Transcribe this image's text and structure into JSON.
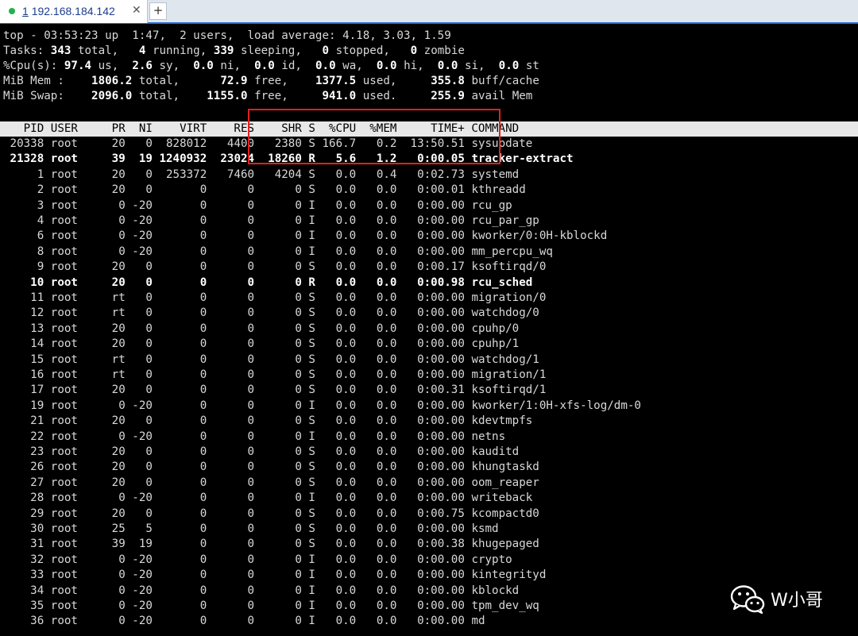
{
  "tab": {
    "number": "1",
    "host": "192.168.184.142",
    "close_glyph": "✕",
    "add_glyph": "+"
  },
  "summary": {
    "line1": "top - 03:53:23 up  1:47,  2 users,  load average: 4.18, 3.03, 1.59",
    "tasks": {
      "label": "Tasks:",
      "total": "343",
      "total_label": "total,",
      "running": "4",
      "running_label": "running,",
      "sleeping": "339",
      "sleeping_label": "sleeping,",
      "stopped": "0",
      "stopped_label": "stopped,",
      "zombie": "0",
      "zombie_label": "zombie"
    },
    "cpu": {
      "label": "%Cpu(s):",
      "us": "97.4",
      "us_label": "us,",
      "sy": "2.6",
      "sy_label": "sy,",
      "ni": "0.0",
      "ni_label": "ni,",
      "id": "0.0",
      "id_label": "id,",
      "wa": "0.0",
      "wa_label": "wa,",
      "hi": "0.0",
      "hi_label": "hi,",
      "si": "0.0",
      "si_label": "si,",
      "st": "0.0",
      "st_label": "st"
    },
    "mem": {
      "label": "MiB Mem :",
      "total": "1806.2",
      "total_label": "total,",
      "free": "72.9",
      "free_label": "free,",
      "used": "1377.5",
      "used_label": "used,",
      "buff": "355.8",
      "buff_label": "buff/cache"
    },
    "swap": {
      "label": "MiB Swap:",
      "total": "2096.0",
      "total_label": "total,",
      "free": "1155.0",
      "free_label": "free,",
      "used": "941.0",
      "used_label": "used.",
      "avail": "255.9",
      "avail_label": "avail Mem"
    }
  },
  "columns": [
    "PID",
    "USER",
    "PR",
    "NI",
    "VIRT",
    "RES",
    "SHR",
    "S",
    "%CPU",
    "%MEM",
    "TIME+",
    "COMMAND"
  ],
  "processes": [
    {
      "pid": "20338",
      "user": "root",
      "pr": "20",
      "ni": "0",
      "virt": "828012",
      "res": "4400",
      "shr": "2380",
      "s": "S",
      "cpu": "166.7",
      "mem": "0.2",
      "time": "13:50.51",
      "cmd": "sysupdate",
      "bold": false
    },
    {
      "pid": "21328",
      "user": "root",
      "pr": "39",
      "ni": "19",
      "virt": "1240932",
      "res": "23024",
      "shr": "18260",
      "s": "R",
      "cpu": "5.6",
      "mem": "1.2",
      "time": "0:00.05",
      "cmd": "tracker-extract",
      "bold": true
    },
    {
      "pid": "1",
      "user": "root",
      "pr": "20",
      "ni": "0",
      "virt": "253372",
      "res": "7460",
      "shr": "4204",
      "s": "S",
      "cpu": "0.0",
      "mem": "0.4",
      "time": "0:02.73",
      "cmd": "systemd",
      "bold": false
    },
    {
      "pid": "2",
      "user": "root",
      "pr": "20",
      "ni": "0",
      "virt": "0",
      "res": "0",
      "shr": "0",
      "s": "S",
      "cpu": "0.0",
      "mem": "0.0",
      "time": "0:00.01",
      "cmd": "kthreadd",
      "bold": false
    },
    {
      "pid": "3",
      "user": "root",
      "pr": "0",
      "ni": "-20",
      "virt": "0",
      "res": "0",
      "shr": "0",
      "s": "I",
      "cpu": "0.0",
      "mem": "0.0",
      "time": "0:00.00",
      "cmd": "rcu_gp",
      "bold": false
    },
    {
      "pid": "4",
      "user": "root",
      "pr": "0",
      "ni": "-20",
      "virt": "0",
      "res": "0",
      "shr": "0",
      "s": "I",
      "cpu": "0.0",
      "mem": "0.0",
      "time": "0:00.00",
      "cmd": "rcu_par_gp",
      "bold": false
    },
    {
      "pid": "6",
      "user": "root",
      "pr": "0",
      "ni": "-20",
      "virt": "0",
      "res": "0",
      "shr": "0",
      "s": "I",
      "cpu": "0.0",
      "mem": "0.0",
      "time": "0:00.00",
      "cmd": "kworker/0:0H-kblockd",
      "bold": false
    },
    {
      "pid": "8",
      "user": "root",
      "pr": "0",
      "ni": "-20",
      "virt": "0",
      "res": "0",
      "shr": "0",
      "s": "I",
      "cpu": "0.0",
      "mem": "0.0",
      "time": "0:00.00",
      "cmd": "mm_percpu_wq",
      "bold": false
    },
    {
      "pid": "9",
      "user": "root",
      "pr": "20",
      "ni": "0",
      "virt": "0",
      "res": "0",
      "shr": "0",
      "s": "S",
      "cpu": "0.0",
      "mem": "0.0",
      "time": "0:00.17",
      "cmd": "ksoftirqd/0",
      "bold": false
    },
    {
      "pid": "10",
      "user": "root",
      "pr": "20",
      "ni": "0",
      "virt": "0",
      "res": "0",
      "shr": "0",
      "s": "R",
      "cpu": "0.0",
      "mem": "0.0",
      "time": "0:00.98",
      "cmd": "rcu_sched",
      "bold": true
    },
    {
      "pid": "11",
      "user": "root",
      "pr": "rt",
      "ni": "0",
      "virt": "0",
      "res": "0",
      "shr": "0",
      "s": "S",
      "cpu": "0.0",
      "mem": "0.0",
      "time": "0:00.00",
      "cmd": "migration/0",
      "bold": false
    },
    {
      "pid": "12",
      "user": "root",
      "pr": "rt",
      "ni": "0",
      "virt": "0",
      "res": "0",
      "shr": "0",
      "s": "S",
      "cpu": "0.0",
      "mem": "0.0",
      "time": "0:00.00",
      "cmd": "watchdog/0",
      "bold": false
    },
    {
      "pid": "13",
      "user": "root",
      "pr": "20",
      "ni": "0",
      "virt": "0",
      "res": "0",
      "shr": "0",
      "s": "S",
      "cpu": "0.0",
      "mem": "0.0",
      "time": "0:00.00",
      "cmd": "cpuhp/0",
      "bold": false
    },
    {
      "pid": "14",
      "user": "root",
      "pr": "20",
      "ni": "0",
      "virt": "0",
      "res": "0",
      "shr": "0",
      "s": "S",
      "cpu": "0.0",
      "mem": "0.0",
      "time": "0:00.00",
      "cmd": "cpuhp/1",
      "bold": false
    },
    {
      "pid": "15",
      "user": "root",
      "pr": "rt",
      "ni": "0",
      "virt": "0",
      "res": "0",
      "shr": "0",
      "s": "S",
      "cpu": "0.0",
      "mem": "0.0",
      "time": "0:00.00",
      "cmd": "watchdog/1",
      "bold": false
    },
    {
      "pid": "16",
      "user": "root",
      "pr": "rt",
      "ni": "0",
      "virt": "0",
      "res": "0",
      "shr": "0",
      "s": "S",
      "cpu": "0.0",
      "mem": "0.0",
      "time": "0:00.00",
      "cmd": "migration/1",
      "bold": false
    },
    {
      "pid": "17",
      "user": "root",
      "pr": "20",
      "ni": "0",
      "virt": "0",
      "res": "0",
      "shr": "0",
      "s": "S",
      "cpu": "0.0",
      "mem": "0.0",
      "time": "0:00.31",
      "cmd": "ksoftirqd/1",
      "bold": false
    },
    {
      "pid": "19",
      "user": "root",
      "pr": "0",
      "ni": "-20",
      "virt": "0",
      "res": "0",
      "shr": "0",
      "s": "I",
      "cpu": "0.0",
      "mem": "0.0",
      "time": "0:00.00",
      "cmd": "kworker/1:0H-xfs-log/dm-0",
      "bold": false
    },
    {
      "pid": "21",
      "user": "root",
      "pr": "20",
      "ni": "0",
      "virt": "0",
      "res": "0",
      "shr": "0",
      "s": "S",
      "cpu": "0.0",
      "mem": "0.0",
      "time": "0:00.00",
      "cmd": "kdevtmpfs",
      "bold": false
    },
    {
      "pid": "22",
      "user": "root",
      "pr": "0",
      "ni": "-20",
      "virt": "0",
      "res": "0",
      "shr": "0",
      "s": "I",
      "cpu": "0.0",
      "mem": "0.0",
      "time": "0:00.00",
      "cmd": "netns",
      "bold": false
    },
    {
      "pid": "23",
      "user": "root",
      "pr": "20",
      "ni": "0",
      "virt": "0",
      "res": "0",
      "shr": "0",
      "s": "S",
      "cpu": "0.0",
      "mem": "0.0",
      "time": "0:00.00",
      "cmd": "kauditd",
      "bold": false
    },
    {
      "pid": "26",
      "user": "root",
      "pr": "20",
      "ni": "0",
      "virt": "0",
      "res": "0",
      "shr": "0",
      "s": "S",
      "cpu": "0.0",
      "mem": "0.0",
      "time": "0:00.00",
      "cmd": "khungtaskd",
      "bold": false
    },
    {
      "pid": "27",
      "user": "root",
      "pr": "20",
      "ni": "0",
      "virt": "0",
      "res": "0",
      "shr": "0",
      "s": "S",
      "cpu": "0.0",
      "mem": "0.0",
      "time": "0:00.00",
      "cmd": "oom_reaper",
      "bold": false
    },
    {
      "pid": "28",
      "user": "root",
      "pr": "0",
      "ni": "-20",
      "virt": "0",
      "res": "0",
      "shr": "0",
      "s": "I",
      "cpu": "0.0",
      "mem": "0.0",
      "time": "0:00.00",
      "cmd": "writeback",
      "bold": false
    },
    {
      "pid": "29",
      "user": "root",
      "pr": "20",
      "ni": "0",
      "virt": "0",
      "res": "0",
      "shr": "0",
      "s": "S",
      "cpu": "0.0",
      "mem": "0.0",
      "time": "0:00.75",
      "cmd": "kcompactd0",
      "bold": false
    },
    {
      "pid": "30",
      "user": "root",
      "pr": "25",
      "ni": "5",
      "virt": "0",
      "res": "0",
      "shr": "0",
      "s": "S",
      "cpu": "0.0",
      "mem": "0.0",
      "time": "0:00.00",
      "cmd": "ksmd",
      "bold": false
    },
    {
      "pid": "31",
      "user": "root",
      "pr": "39",
      "ni": "19",
      "virt": "0",
      "res": "0",
      "shr": "0",
      "s": "S",
      "cpu": "0.0",
      "mem": "0.0",
      "time": "0:00.38",
      "cmd": "khugepaged",
      "bold": false
    },
    {
      "pid": "32",
      "user": "root",
      "pr": "0",
      "ni": "-20",
      "virt": "0",
      "res": "0",
      "shr": "0",
      "s": "I",
      "cpu": "0.0",
      "mem": "0.0",
      "time": "0:00.00",
      "cmd": "crypto",
      "bold": false
    },
    {
      "pid": "33",
      "user": "root",
      "pr": "0",
      "ni": "-20",
      "virt": "0",
      "res": "0",
      "shr": "0",
      "s": "I",
      "cpu": "0.0",
      "mem": "0.0",
      "time": "0:00.00",
      "cmd": "kintegrityd",
      "bold": false
    },
    {
      "pid": "34",
      "user": "root",
      "pr": "0",
      "ni": "-20",
      "virt": "0",
      "res": "0",
      "shr": "0",
      "s": "I",
      "cpu": "0.0",
      "mem": "0.0",
      "time": "0:00.00",
      "cmd": "kblockd",
      "bold": false
    },
    {
      "pid": "35",
      "user": "root",
      "pr": "0",
      "ni": "-20",
      "virt": "0",
      "res": "0",
      "shr": "0",
      "s": "I",
      "cpu": "0.0",
      "mem": "0.0",
      "time": "0:00.00",
      "cmd": "tpm_dev_wq",
      "bold": false
    },
    {
      "pid": "36",
      "user": "root",
      "pr": "0",
      "ni": "-20",
      "virt": "0",
      "res": "0",
      "shr": "0",
      "s": "I",
      "cpu": "0.0",
      "mem": "0.0",
      "time": "0:00.00",
      "cmd": "md",
      "bold": false
    }
  ],
  "watermark": {
    "text": "W小哥",
    "icon": "wechat-icon"
  },
  "colors": {
    "tab_dot": "#22b14c",
    "tab_accent": "#2a6fd6",
    "highlight_box": "#e02020",
    "terminal_bg": "#000000"
  }
}
